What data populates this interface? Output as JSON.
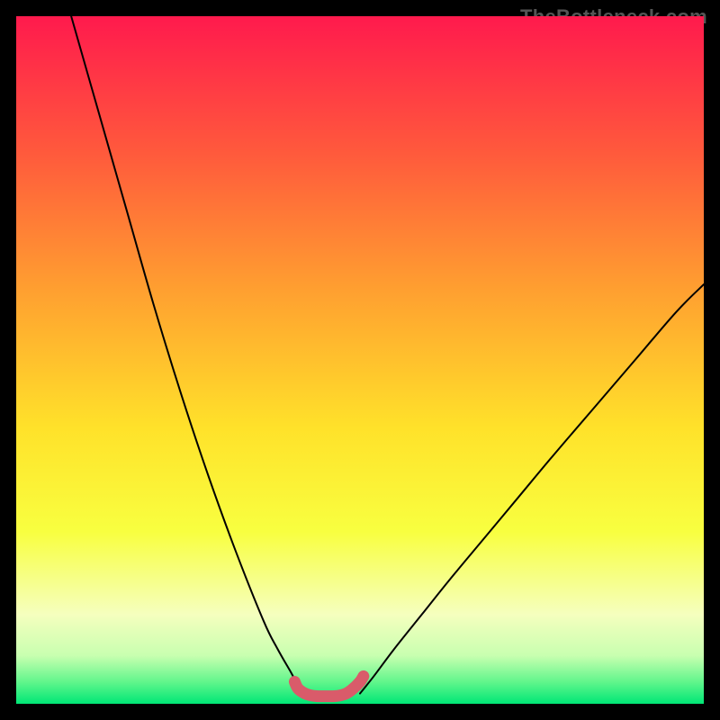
{
  "attribution": "TheBottleneck.com",
  "chart_data": {
    "type": "line",
    "title": "",
    "xlabel": "",
    "ylabel": "",
    "xlim": [
      0,
      100
    ],
    "ylim": [
      0,
      100
    ],
    "grid": false,
    "legend": false,
    "series": [
      {
        "name": "left-curve",
        "stroke": "#000000",
        "x": [
          8,
          12,
          16,
          20,
          24,
          28,
          32,
          36,
          38,
          40,
          40.7,
          42
        ],
        "y": [
          100,
          86,
          72,
          58,
          45,
          33,
          22,
          12,
          8,
          4.5,
          3.2,
          1.5
        ]
      },
      {
        "name": "right-curve",
        "stroke": "#000000",
        "x": [
          50,
          52,
          55,
          59,
          63,
          68,
          73,
          78,
          84,
          90,
          96,
          100
        ],
        "y": [
          1.5,
          4,
          8,
          13,
          18,
          24,
          30,
          36,
          43,
          50,
          57,
          61
        ]
      },
      {
        "name": "flat-segment-highlight",
        "stroke": "#d95b6a",
        "x": [
          40.5,
          41,
          42,
          43,
          44,
          45,
          46,
          47,
          48,
          49,
          50,
          50.5
        ],
        "y": [
          3.2,
          2.2,
          1.5,
          1.2,
          1.1,
          1.1,
          1.1,
          1.2,
          1.5,
          2.2,
          3.2,
          4.0
        ]
      }
    ],
    "gradient_background": {
      "type": "vertical-linear",
      "stops": [
        {
          "offset": 0.0,
          "color": "#ff1a4d"
        },
        {
          "offset": 0.2,
          "color": "#ff5a3c"
        },
        {
          "offset": 0.4,
          "color": "#ffa030"
        },
        {
          "offset": 0.6,
          "color": "#ffe22a"
        },
        {
          "offset": 0.75,
          "color": "#f8ff40"
        },
        {
          "offset": 0.87,
          "color": "#f5ffbe"
        },
        {
          "offset": 0.93,
          "color": "#c8ffb0"
        },
        {
          "offset": 0.97,
          "color": "#5cf58a"
        },
        {
          "offset": 1.0,
          "color": "#00e676"
        }
      ]
    }
  }
}
